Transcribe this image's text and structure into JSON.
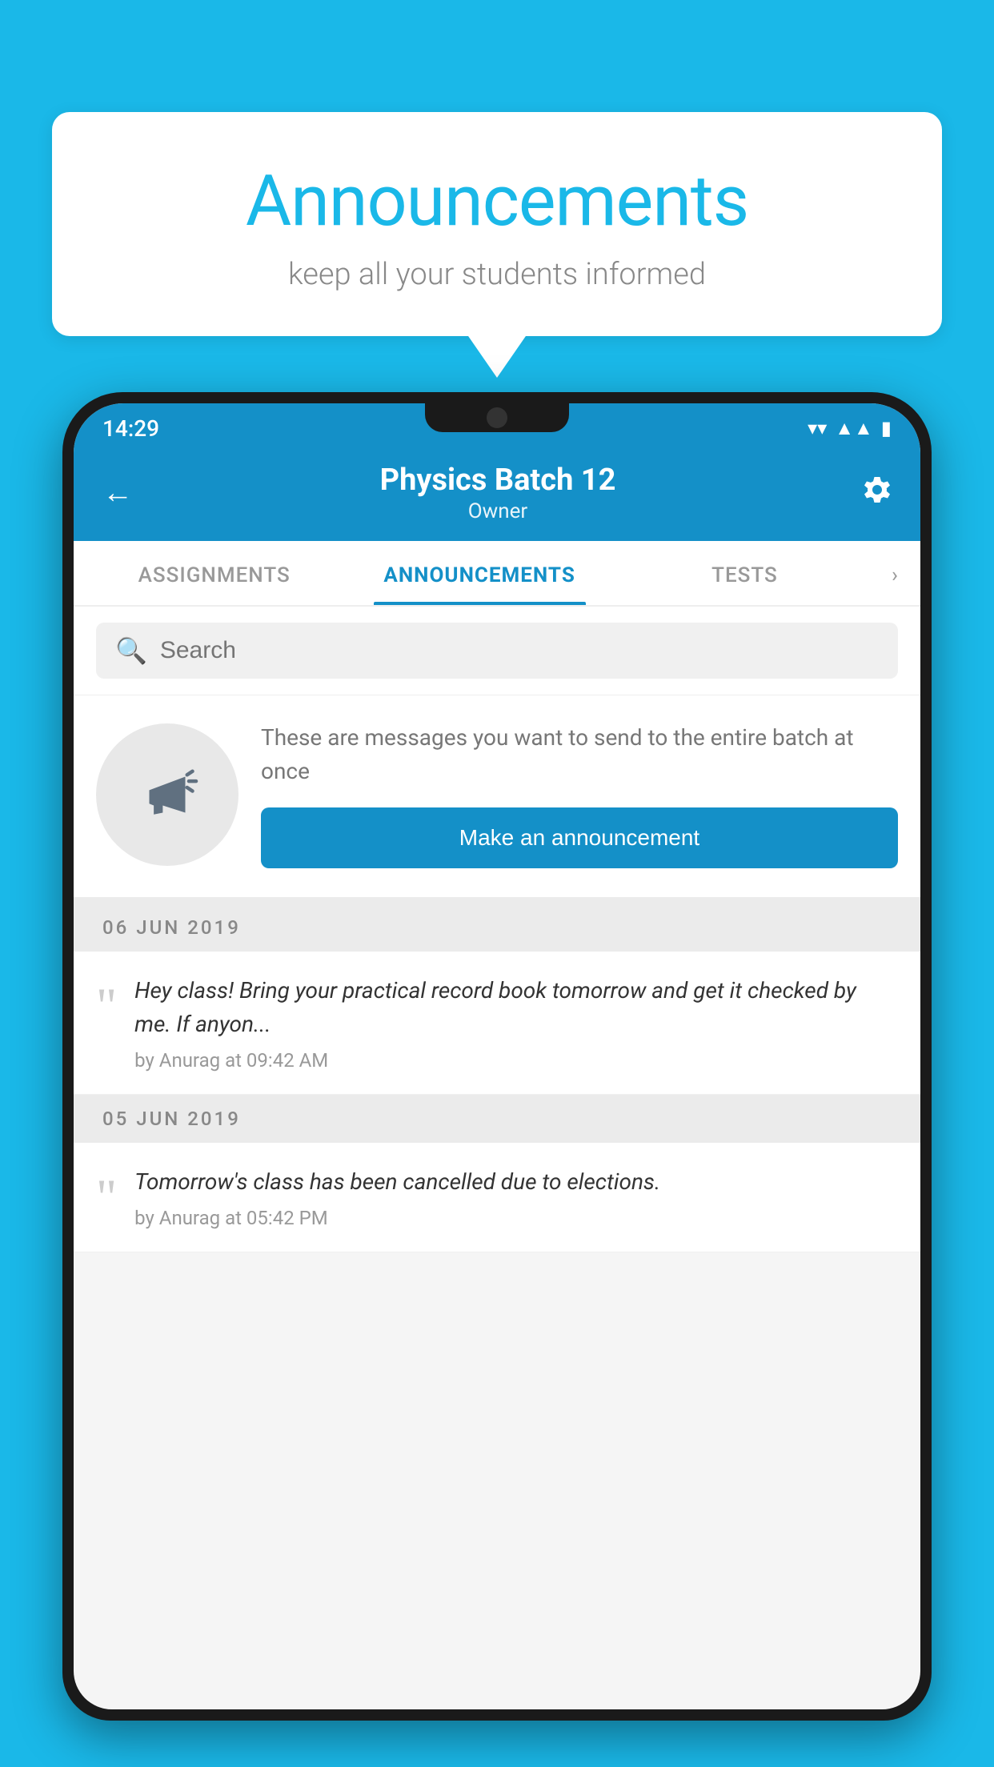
{
  "background": {
    "color": "#1ab8e8"
  },
  "speech_bubble": {
    "title": "Announcements",
    "subtitle": "keep all your students informed"
  },
  "phone": {
    "status_bar": {
      "time": "14:29"
    },
    "header": {
      "title": "Physics Batch 12",
      "subtitle": "Owner",
      "back_label": "←",
      "settings_label": "⚙"
    },
    "tabs": [
      {
        "label": "ASSIGNMENTS",
        "active": false
      },
      {
        "label": "ANNOUNCEMENTS",
        "active": true
      },
      {
        "label": "TESTS",
        "active": false
      }
    ],
    "search": {
      "placeholder": "Search"
    },
    "announcement_prompt": {
      "description": "These are messages you want to send to the entire batch at once",
      "button_label": "Make an announcement"
    },
    "date_groups": [
      {
        "date": "06  JUN  2019",
        "items": [
          {
            "text": "Hey class! Bring your practical record book tomorrow and get it checked by me. If anyon...",
            "meta": "by Anurag at 09:42 AM"
          }
        ]
      },
      {
        "date": "05  JUN  2019",
        "items": [
          {
            "text": "Tomorrow's class has been cancelled due to elections.",
            "meta": "by Anurag at 05:42 PM"
          }
        ]
      }
    ]
  }
}
